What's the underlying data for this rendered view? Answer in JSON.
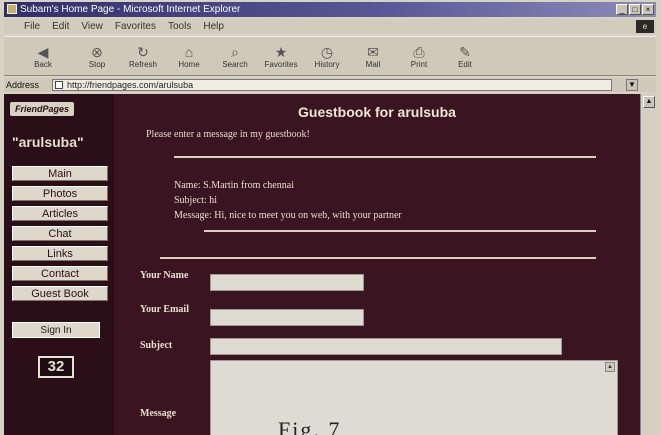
{
  "window": {
    "title": "Subam's Home Page - Microsoft Internet Explorer",
    "controls": [
      "_",
      "□",
      "×"
    ]
  },
  "menu": {
    "items": [
      "File",
      "Edit",
      "View",
      "Favorites",
      "Tools",
      "Help"
    ]
  },
  "toolbar": {
    "buttons": [
      {
        "label": "Back",
        "icon": "back-arrow-icon",
        "glyph": "◀"
      },
      {
        "label": "Stop",
        "icon": "stop-icon",
        "glyph": "⊗"
      },
      {
        "label": "Refresh",
        "icon": "refresh-icon",
        "glyph": "↻"
      },
      {
        "label": "Home",
        "icon": "home-icon",
        "glyph": "⌂"
      },
      {
        "label": "Search",
        "icon": "search-icon",
        "glyph": "⌕"
      },
      {
        "label": "Favorites",
        "icon": "favorites-icon",
        "glyph": "★"
      },
      {
        "label": "History",
        "icon": "history-icon",
        "glyph": "◷"
      },
      {
        "label": "Mail",
        "icon": "mail-icon",
        "glyph": "✉"
      },
      {
        "label": "Print",
        "icon": "print-icon",
        "glyph": "⎙"
      },
      {
        "label": "Edit",
        "icon": "edit-icon",
        "glyph": "✎"
      }
    ]
  },
  "address": {
    "label": "Address",
    "value": "http://friendpages.com/arulsuba"
  },
  "sidebar": {
    "logo": "FriendPages",
    "username": "\"arulsuba\"",
    "nav": [
      "Main",
      "Photos",
      "Articles",
      "Chat",
      "Links",
      "Contact",
      "Guest Book"
    ],
    "signin": "Sign In",
    "counter": "32"
  },
  "guestbook": {
    "title": "Guestbook for arulsuba",
    "subtitle": "Please enter a message in my guestbook!",
    "entry": {
      "name_line": "Name: S.Martin from chennai",
      "subject_line": "Subject: hi",
      "message_line": "Message: Hi, nice to meet you on web, with your partner"
    },
    "form": {
      "your_name_label": "Your Name",
      "your_email_label": "Your Email",
      "subject_label": "Subject",
      "message_label": "Message"
    }
  },
  "caption": "Fig. 7"
}
